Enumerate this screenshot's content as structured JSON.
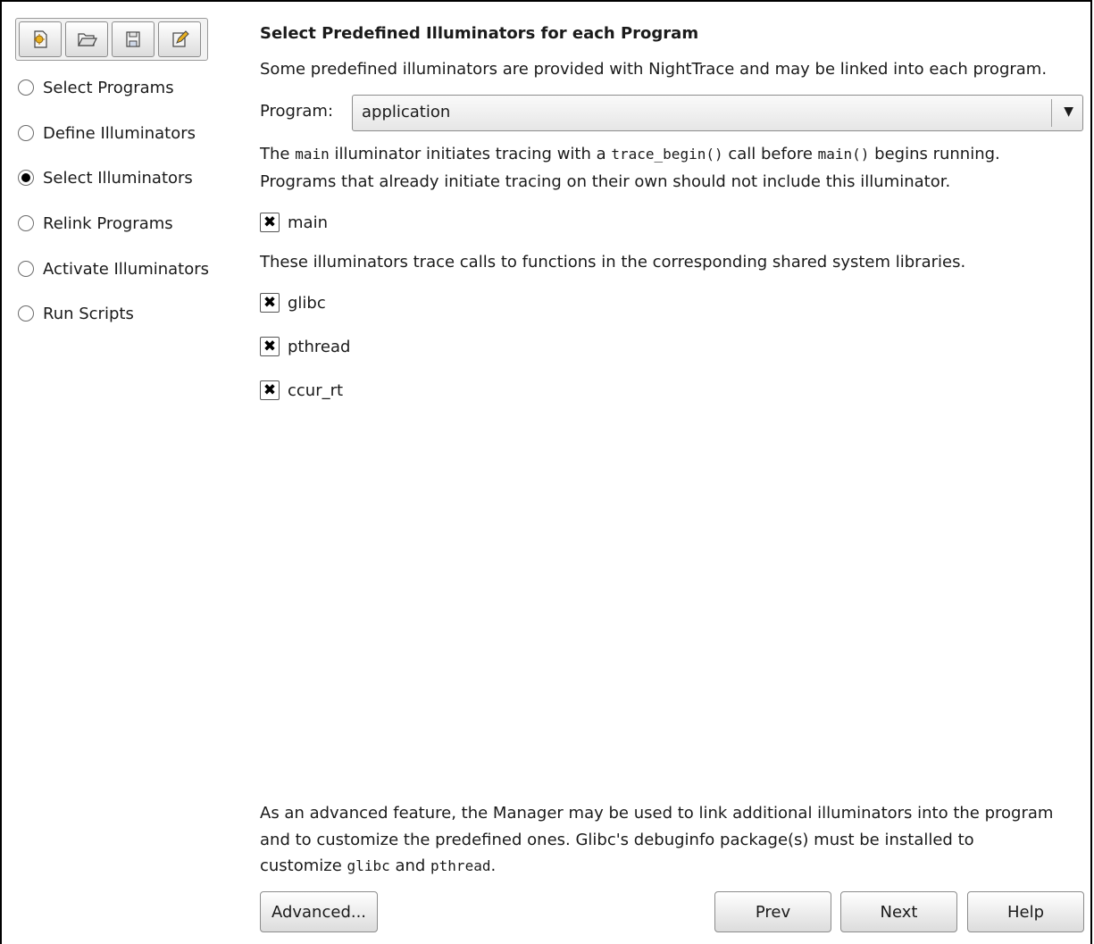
{
  "toolbar": {
    "buttons": [
      {
        "name": "new-session-icon"
      },
      {
        "name": "open-folder-icon"
      },
      {
        "name": "save-icon"
      },
      {
        "name": "edit-icon"
      }
    ]
  },
  "sidebar": {
    "items": [
      {
        "label": "Select Programs",
        "selected": false
      },
      {
        "label": "Define Illuminators",
        "selected": false
      },
      {
        "label": "Select Illuminators",
        "selected": true
      },
      {
        "label": "Relink Programs",
        "selected": false
      },
      {
        "label": "Activate Illuminators",
        "selected": false
      },
      {
        "label": "Run Scripts",
        "selected": false
      }
    ]
  },
  "main": {
    "title": "Select Predefined Illuminators for each Program",
    "intro": "Some predefined illuminators are provided with NightTrace and may be linked into each program.",
    "program_label": "Program:",
    "program_value": "application",
    "main_desc": {
      "p1": "The ",
      "code1": "main",
      "p2": " illuminator initiates tracing with a ",
      "code2": "trace_begin()",
      "p3": " call before ",
      "code3": "main()",
      "p4": " begins running.",
      "line2": "Programs that already initiate tracing on their own should not include this illuminator."
    },
    "main_checkbox": {
      "label": "main",
      "checked": true
    },
    "libs_desc": "These illuminators trace calls to functions in the corresponding shared system libraries.",
    "lib_checkboxes": [
      {
        "label": "glibc",
        "checked": true
      },
      {
        "label": "pthread",
        "checked": true
      },
      {
        "label": "ccur_rt",
        "checked": true
      }
    ],
    "advanced_note": {
      "line1": "As an advanced feature, the Manager may be used to link additional illuminators into the program",
      "line2": "and to customize the predefined ones. Glibc's debuginfo package(s) must be installed to",
      "line3_pre": "customize ",
      "code1": "glibc",
      "line3_mid": " and ",
      "code2": "pthread",
      "line3_post": "."
    }
  },
  "buttons": {
    "advanced": "Advanced...",
    "prev": "Prev",
    "next": "Next",
    "help": "Help"
  }
}
